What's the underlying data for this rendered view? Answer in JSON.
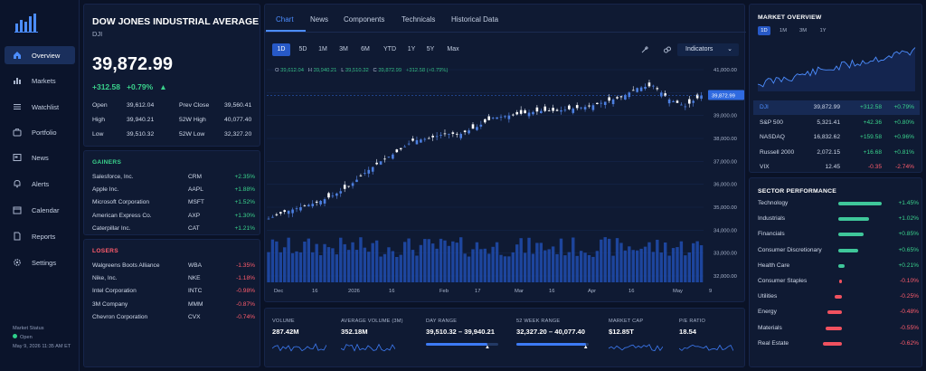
{
  "colors": {
    "up": "#3ad28c",
    "down": "#ff5c6c",
    "accent": "#2759c7",
    "bg": "#0a1226",
    "candle": "#4c7fe0",
    "volume": "#1f4aa8"
  },
  "sidebar": {
    "items": [
      {
        "label": "Overview",
        "icon": "home-icon",
        "active": true
      },
      {
        "label": "Markets",
        "icon": "bar-chart-icon"
      },
      {
        "label": "Watchlist",
        "icon": "list-icon"
      },
      {
        "label": "Portfolio",
        "icon": "briefcase-icon"
      },
      {
        "label": "News",
        "icon": "newspaper-icon"
      },
      {
        "label": "Alerts",
        "icon": "bell-icon"
      },
      {
        "label": "Calendar",
        "icon": "calendar-icon"
      },
      {
        "label": "Reports",
        "icon": "document-icon"
      },
      {
        "label": "Settings",
        "icon": "gear-icon"
      }
    ],
    "status": {
      "title": "Market Status",
      "state": "Open",
      "time": "May 9, 2026  11:35 AM ET"
    }
  },
  "quote": {
    "name": "DOW JONES INDUSTRIAL AVERAGE",
    "symbol": "DJI",
    "price": "39,872.99",
    "change": "+312.58",
    "change_pct": "+0.79%",
    "stats": [
      {
        "l1": "Open",
        "v1": "39,612.04",
        "l2": "Prev Close",
        "v2": "39,560.41"
      },
      {
        "l1": "High",
        "v1": "39,940.21",
        "l2": "52W High",
        "v2": "40,077.40"
      },
      {
        "l1": "Low",
        "v1": "39,510.32",
        "l2": "52W Low",
        "v2": "32,327.20"
      }
    ]
  },
  "gainers": {
    "title": "GAINERS",
    "rows": [
      {
        "name": "Salesforce, Inc.",
        "ticker": "CRM",
        "chg": "+2.35%"
      },
      {
        "name": "Apple Inc.",
        "ticker": "AAPL",
        "chg": "+1.88%"
      },
      {
        "name": "Microsoft Corporation",
        "ticker": "MSFT",
        "chg": "+1.52%"
      },
      {
        "name": "American Express Co.",
        "ticker": "AXP",
        "chg": "+1.30%"
      },
      {
        "name": "Caterpillar Inc.",
        "ticker": "CAT",
        "chg": "+1.21%"
      }
    ]
  },
  "losers": {
    "title": "LOSERS",
    "rows": [
      {
        "name": "Walgreens Boots Alliance",
        "ticker": "WBA",
        "chg": "-1.35%"
      },
      {
        "name": "Nike, Inc.",
        "ticker": "NKE",
        "chg": "-1.18%"
      },
      {
        "name": "Intel Corporation",
        "ticker": "INTC",
        "chg": "-0.98%"
      },
      {
        "name": "3M Company",
        "ticker": "MMM",
        "chg": "-0.87%"
      },
      {
        "name": "Chevron Corporation",
        "ticker": "CVX",
        "chg": "-0.74%"
      }
    ]
  },
  "chart": {
    "tabs": [
      "Chart",
      "News",
      "Components",
      "Technicals",
      "Historical Data"
    ],
    "ranges": [
      "1D",
      "5D",
      "1M",
      "3M",
      "6M",
      "YTD",
      "1Y",
      "5Y",
      "Max"
    ],
    "indicators_label": "Indicators",
    "ohlc": {
      "o_label": "O",
      "o": "39,612.04",
      "h_label": "H",
      "h": "39,940.21",
      "l_label": "L",
      "l": "39,510.32",
      "c_label": "C",
      "c": "39,872.99",
      "chg": "+312.58 (+0.79%)"
    },
    "last_price_tag": "39,872.99"
  },
  "chart_data": {
    "type": "line",
    "title": "",
    "x_ticks": [
      "Dec",
      "16",
      "2026",
      "16",
      "Feb",
      "17",
      "Mar",
      "16",
      "Apr",
      "16",
      "May",
      "9"
    ],
    "y_ticks": [
      "41,000.00",
      "40,000.00",
      "39,000.00",
      "38,000.00",
      "37,000.00",
      "36,000.00",
      "35,000.00",
      "34,000.00",
      "33,000.00",
      "32,000.00"
    ],
    "ylim": [
      32000,
      41000
    ],
    "price_anchors": [
      [
        0,
        34500
      ],
      [
        4,
        34800
      ],
      [
        8,
        35000
      ],
      [
        12,
        35200
      ],
      [
        16,
        35500
      ],
      [
        20,
        35900
      ],
      [
        24,
        36500
      ],
      [
        28,
        37000
      ],
      [
        32,
        37400
      ],
      [
        36,
        37900
      ],
      [
        40,
        38000
      ],
      [
        44,
        38200
      ],
      [
        48,
        38200
      ],
      [
        52,
        38500
      ],
      [
        56,
        38900
      ],
      [
        60,
        39000
      ],
      [
        64,
        39100
      ],
      [
        68,
        39200
      ],
      [
        72,
        39200
      ],
      [
        76,
        39300
      ],
      [
        80,
        39400
      ],
      [
        84,
        39600
      ],
      [
        88,
        39800
      ],
      [
        92,
        40200
      ],
      [
        96,
        40300
      ],
      [
        100,
        39700
      ],
      [
        104,
        39400
      ],
      [
        108,
        39872.99
      ]
    ],
    "last_value": 39872.99
  },
  "stats_row": [
    {
      "label": "VOLUME",
      "value": "287.42M"
    },
    {
      "label": "AVERAGE VOLUME (3M)",
      "value": "352.18M"
    },
    {
      "label": "DAY RANGE",
      "value": "39,510.32 – 39,940.21",
      "fill": 0.85
    },
    {
      "label": "52 WEEK RANGE",
      "value": "32,327.20 – 40,077.40",
      "fill": 0.96
    },
    {
      "label": "MARKET CAP",
      "value": "$12.85T"
    },
    {
      "label": "P/E RATIO",
      "value": "18.54"
    }
  ],
  "overview": {
    "title": "MARKET OVERVIEW",
    "tabs": [
      "1D",
      "1M",
      "3M",
      "1Y"
    ],
    "rows": [
      {
        "name": "DJI",
        "price": "39,872.99",
        "chg": "+312.58",
        "pct": "+0.79%",
        "up": true,
        "hl": true
      },
      {
        "name": "S&P 500",
        "price": "5,321.41",
        "chg": "+42.36",
        "pct": "+0.80%",
        "up": true
      },
      {
        "name": "NASDAQ",
        "price": "16,832.62",
        "chg": "+159.58",
        "pct": "+0.96%",
        "up": true
      },
      {
        "name": "Russell 2000",
        "price": "2,072.15",
        "chg": "+16.68",
        "pct": "+0.81%",
        "up": true
      },
      {
        "name": "VIX",
        "price": "12.45",
        "chg": "-0.35",
        "pct": "-2.74%",
        "up": false
      }
    ]
  },
  "sectors": {
    "title": "SECTOR PERFORMANCE",
    "rows": [
      {
        "name": "Technology",
        "pct": "+1.45%",
        "v": 1.45
      },
      {
        "name": "Industrials",
        "pct": "+1.02%",
        "v": 1.02
      },
      {
        "name": "Financials",
        "pct": "+0.85%",
        "v": 0.85
      },
      {
        "name": "Consumer Discretionary",
        "pct": "+0.65%",
        "v": 0.65
      },
      {
        "name": "Health Care",
        "pct": "+0.21%",
        "v": 0.21
      },
      {
        "name": "Consumer Staples",
        "pct": "-0.10%",
        "v": -0.1
      },
      {
        "name": "Utilities",
        "pct": "-0.25%",
        "v": -0.25
      },
      {
        "name": "Energy",
        "pct": "-0.48%",
        "v": -0.48
      },
      {
        "name": "Materials",
        "pct": "-0.55%",
        "v": -0.55
      },
      {
        "name": "Real Estate",
        "pct": "-0.62%",
        "v": -0.62
      }
    ]
  }
}
